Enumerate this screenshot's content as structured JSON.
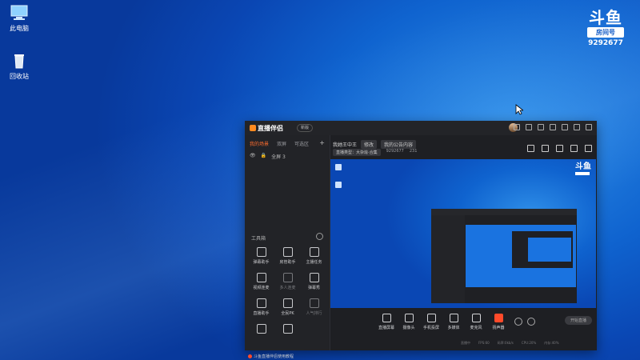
{
  "desktop": {
    "icons": [
      {
        "label": "此电脑",
        "icon": "computer-icon"
      },
      {
        "label": "回收站",
        "icon": "recycle-bin-icon"
      }
    ]
  },
  "watermark": {
    "brand": "斗鱼",
    "room_label": "房间号",
    "room_number": "9292677"
  },
  "app": {
    "name": "直播伴侣",
    "badge": "新版",
    "tabs": [
      "我的场景",
      "双屏",
      "可选区"
    ],
    "scene": "全屏 3",
    "streamer": "我她王中王",
    "edit_btn": "修改",
    "announce": "我的公告内容",
    "category": "直播类型：大杂烩·合集",
    "room_id": "9292677",
    "fans": "231",
    "tools_title": "工具箱",
    "tools": [
      {
        "label": "弹幕助手",
        "dim": false
      },
      {
        "label": "房管助手",
        "dim": false
      },
      {
        "label": "主播任务",
        "dim": false
      },
      {
        "label": "视频连麦",
        "dim": false
      },
      {
        "label": "多人连麦",
        "dim": true
      },
      {
        "label": "弹幕秀",
        "dim": false
      },
      {
        "label": "直播助手",
        "dim": false
      },
      {
        "label": "全民PK",
        "dim": false
      },
      {
        "label": "人气排行",
        "dim": true
      },
      {
        "label": "",
        "dim": false
      },
      {
        "label": "",
        "dim": false
      }
    ],
    "bottom_note": "斗鱼直播伴侣使用教程",
    "controls": [
      {
        "label": "直播屏幕",
        "red": false
      },
      {
        "label": "摄像头",
        "red": false
      },
      {
        "label": "手机投屏",
        "red": false
      },
      {
        "label": "多媒体",
        "red": false
      },
      {
        "label": "麦克风",
        "red": false
      },
      {
        "label": "扬声器",
        "red": true
      }
    ],
    "start_live": "开始直播",
    "status": [
      "直播中",
      "FPS:60",
      "码率:0kb/s",
      "CPU:20%",
      "内存:40%"
    ]
  },
  "colors": {
    "accent": "#ff6d2e",
    "desktop": "#0f63cf",
    "app_bg": "#1e1f23"
  }
}
